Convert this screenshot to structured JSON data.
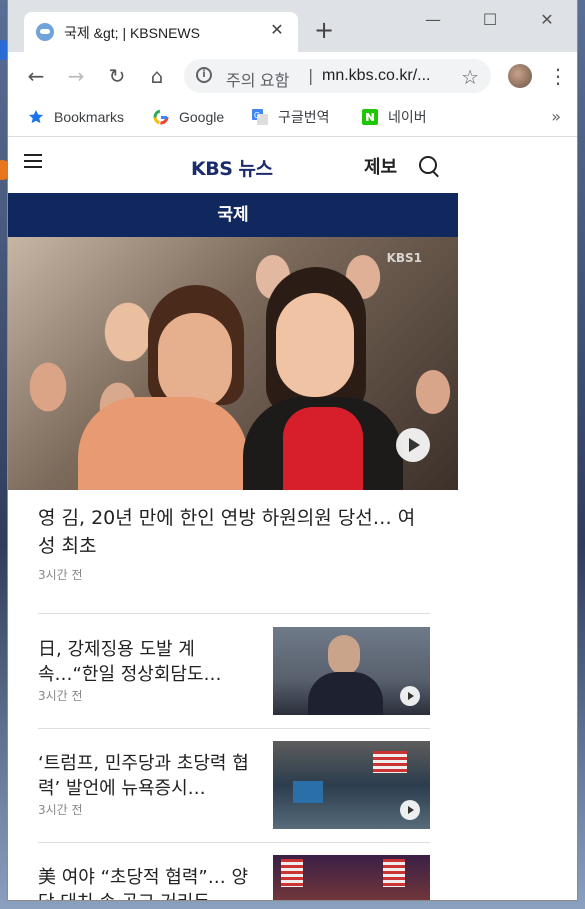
{
  "browser": {
    "tab_title": "국제 &gt; | KBSNEWS",
    "tab_close": "✕",
    "new_tab": "+",
    "window_controls": {
      "minimize": "—",
      "maximize": "☐",
      "close": "✕"
    },
    "nav": {
      "back": "←",
      "forward": "→",
      "reload": "↻",
      "home": "⌂"
    },
    "omnibox": {
      "info_icon": "i",
      "security_label": "주의 요함",
      "separator": "|",
      "url": "mn.kbs.co.kr/..."
    },
    "star": "☆",
    "menu": "⋮",
    "bookmarks": [
      {
        "label": "Bookmarks",
        "icon": "star-icon"
      },
      {
        "label": "Google",
        "icon": "google-icon"
      },
      {
        "label": "구글번역",
        "icon": "translate-icon"
      },
      {
        "label": "네이버",
        "icon": "naver-icon"
      }
    ],
    "bookmarks_more": "»"
  },
  "site": {
    "logo": "KBS 뉴스",
    "report_label": "제보",
    "section_title": "국제",
    "hero_watermark": "KBS1",
    "lead": {
      "title": "영 김, 20년 만에 한인 연방 하원의원 당선… 여성 최초",
      "time": "3시간 전"
    },
    "articles": [
      {
        "title": "日, 강제징용 도발 계속…“한일 정상회담도…",
        "time": "3시간 전"
      },
      {
        "title": "‘트럼프, 민주당과 초당력 협력’ 발언에 뉴욕증시…",
        "time": "3시간 전"
      },
      {
        "title": "美 여야 “초당적 협력”… 양당 대치 속 공고 거리두…",
        "time": ""
      }
    ]
  },
  "colors": {
    "section_bar": "#10285e",
    "logo": "#1a2c6b",
    "tabstrip": "#dee1e6"
  }
}
